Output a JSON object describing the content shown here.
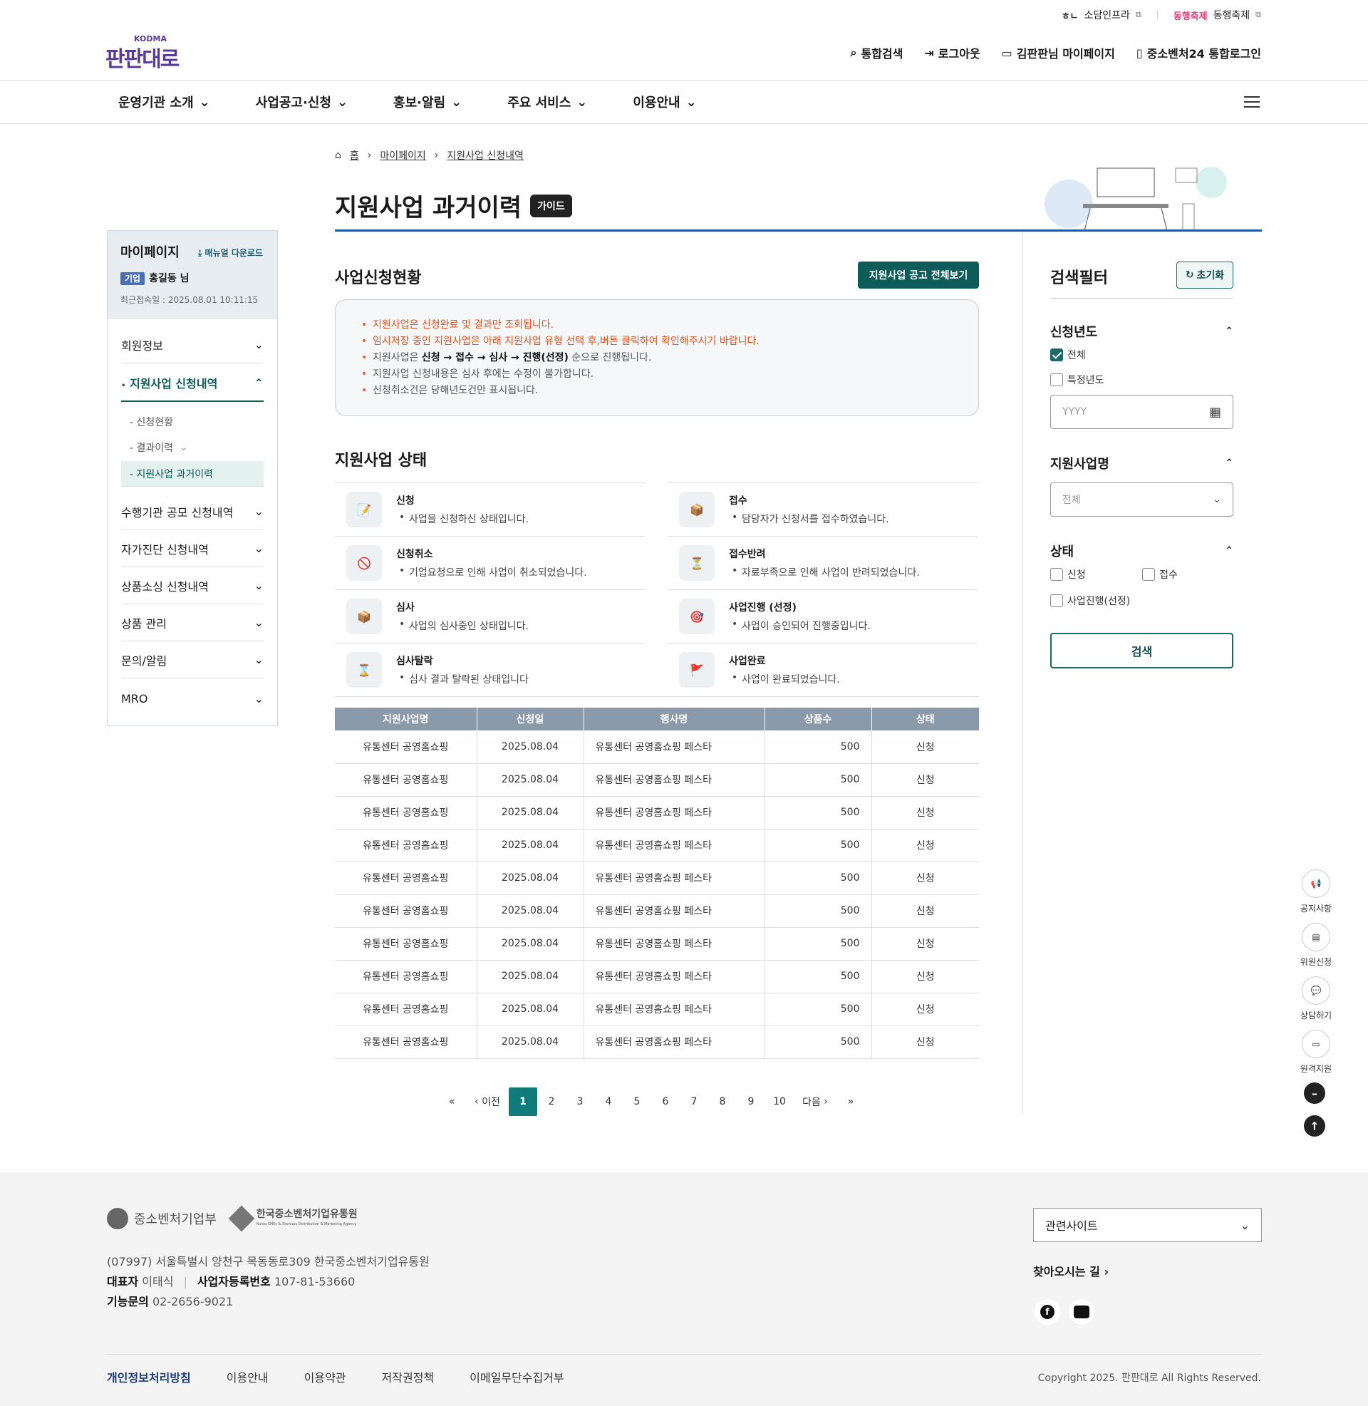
{
  "util": {
    "sodam": "소담인프라",
    "festival_logo": "동행축제",
    "festival": "동행축제"
  },
  "header": {
    "logo": "판판대로",
    "logo_sub": "KODMA",
    "search": "통합검색",
    "logout": "로그아웃",
    "mypage": "김판판님 마이페이지",
    "login24": "중소벤처24 통합로그인"
  },
  "gnb": [
    "운영기관 소개",
    "사업공고·신청",
    "홍보·알림",
    "주요 서비스",
    "이용안내"
  ],
  "breadcrumb": {
    "home": "홈",
    "l1": "마이페이지",
    "l2": "지원사업 신청내역"
  },
  "page": {
    "title": "지원사업 과거이력",
    "guide": "가이드"
  },
  "side": {
    "title": "마이페이지",
    "manual": "매뉴얼 다운로드",
    "badge": "기업",
    "user": "홍길동 님",
    "last_login": "최근접속일 : 2025.08.01 10:11:15",
    "items": [
      "회원정보",
      "지원사업 신청내역",
      "수행기관 공모 신청내역",
      "자가진단 신청내역",
      "상품소싱 신청내역",
      "상품 관리",
      "문의/알림",
      "MRO"
    ],
    "subs": [
      "- 신청현황",
      "- 결과이력",
      "- 지원사업 과거이력"
    ]
  },
  "apply": {
    "title": "사업신청현황",
    "btn": "지원사업 공고 전체보기",
    "notices": [
      "지원사업은 신청완료 및 결과만 조회됩니다.",
      "임시저장 중인 지원사업은 아래 지원사업 유형 선택 후,버튼 클릭하여 확인해주시기 바랍니다.",
      "순으로 진행됩니다.",
      "지원사업 신청내용은 심사 후에는 수정이 불가합니다.",
      "신청취소건은 당해년도건만 표시됩니다."
    ],
    "flow_prefix": "지원사업은 ",
    "flow": "신청 → 접수 → 심사 → 진행(선정)"
  },
  "status": {
    "title": "지원사업 상태",
    "items": [
      {
        "name": "신청",
        "desc": "사업을 신청하신 상태입니다."
      },
      {
        "name": "접수",
        "desc": "담당자가 신청서를 접수하였습니다."
      },
      {
        "name": "신청취소",
        "desc": "기업요청으로 인해 사업이 취소되었습니다."
      },
      {
        "name": "접수반려",
        "desc": "자료부족으로 인해 사업이 반려되었습니다."
      },
      {
        "name": "심사",
        "desc": "사업의 심사중인 상태입니다."
      },
      {
        "name": "사업진행 (선정)",
        "desc": "사업이 승인되어 진행중입니다."
      },
      {
        "name": "심사탈락",
        "desc": "심사 결과 탈락된 상태입니다"
      },
      {
        "name": "사업완료",
        "desc": "사업이 완료되었습니다."
      }
    ]
  },
  "table": {
    "headers": [
      "지원사업명",
      "신청일",
      "행사명",
      "상품수",
      "상태"
    ],
    "rows": [
      [
        "유통센터 공영홈쇼핑",
        "2025.08.04",
        "유통센터 공영홈쇼핑 페스타",
        "500",
        "신청"
      ],
      [
        "유통센터 공영홈쇼핑",
        "2025.08.04",
        "유통센터 공영홈쇼핑 페스타",
        "500",
        "신청"
      ],
      [
        "유통센터 공영홈쇼핑",
        "2025.08.04",
        "유통센터 공영홈쇼핑 페스타",
        "500",
        "신청"
      ],
      [
        "유통센터 공영홈쇼핑",
        "2025.08.04",
        "유통센터 공영홈쇼핑 페스타",
        "500",
        "신청"
      ],
      [
        "유통센터 공영홈쇼핑",
        "2025.08.04",
        "유통센터 공영홈쇼핑 페스타",
        "500",
        "신청"
      ],
      [
        "유통센터 공영홈쇼핑",
        "2025.08.04",
        "유통센터 공영홈쇼핑 페스타",
        "500",
        "신청"
      ],
      [
        "유통센터 공영홈쇼핑",
        "2025.08.04",
        "유통센터 공영홈쇼핑 페스타",
        "500",
        "신청"
      ],
      [
        "유통센터 공영홈쇼핑",
        "2025.08.04",
        "유통센터 공영홈쇼핑 페스타",
        "500",
        "신청"
      ],
      [
        "유통센터 공영홈쇼핑",
        "2025.08.04",
        "유통센터 공영홈쇼핑 페스타",
        "500",
        "신청"
      ],
      [
        "유통센터 공영홈쇼핑",
        "2025.08.04",
        "유통센터 공영홈쇼핑 페스타",
        "500",
        "신청"
      ]
    ]
  },
  "pager": {
    "prev": "이전",
    "next": "다음",
    "pages": [
      "1",
      "2",
      "3",
      "4",
      "5",
      "6",
      "7",
      "8",
      "9",
      "10"
    ],
    "current": "1"
  },
  "filter": {
    "title": "검색필터",
    "reset": "초기화",
    "year": "신청년도",
    "all": "전체",
    "specific": "특정년도",
    "year_ph": "YYYY",
    "biz": "지원사업명",
    "biz_sel": "전체",
    "state": "상태",
    "s1": "신청",
    "s2": "접수",
    "s3": "사업진행(선정)",
    "search": "검색"
  },
  "quick": [
    "공지사항",
    "위원신청",
    "상담하기",
    "원격지원"
  ],
  "footer": {
    "org1": "중소벤처기업부",
    "org2": "한국중소벤처기업유통원",
    "org2_en": "Korea SMEs & Startups Distribution & Marketing Agency",
    "addr": "(07997) 서울특별시 양천구 목동동로309 한국중소벤처기업유통원",
    "ceo_l": "대표자",
    "ceo": "이태식",
    "reg_l": "사업자등록번호",
    "reg": "107-81-53660",
    "tel_l": "기능문의",
    "tel": "02-2656-9021",
    "related": "관련사이트",
    "way": "찾아오시는 길",
    "links": [
      "개인정보처리방침",
      "이용안내",
      "이용약관",
      "저작권정책",
      "이메일무단수집거부"
    ],
    "copy": "Copyright 2025. 판판대로 All Rights Reserved."
  }
}
